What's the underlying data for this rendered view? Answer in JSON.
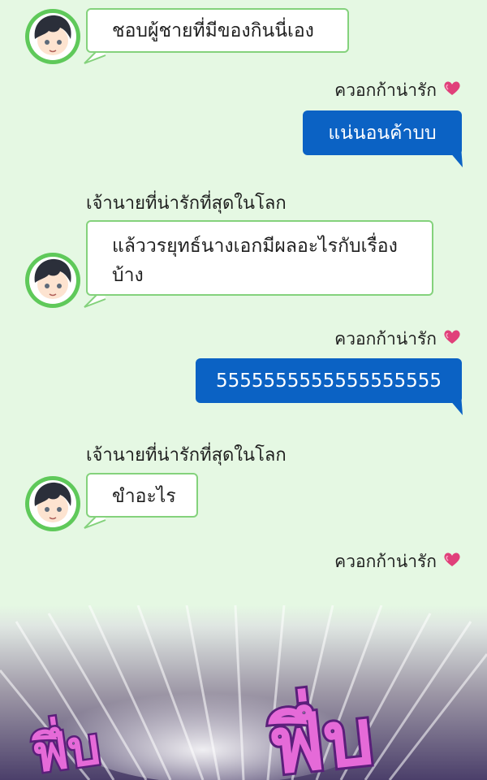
{
  "colors": {
    "background": "#e5f8e3",
    "incoming_bubble_border": "#84d27c",
    "outgoing_bubble": "#0b62c4",
    "heart": "#e0407a"
  },
  "messages": [
    {
      "from": "other",
      "text": "ชอบผู้ชายที่มีของกินนี่เอง"
    },
    {
      "from": "me",
      "sender": "ควอกก้าน่ารัก",
      "text": "แน่นอนค้าบบ"
    },
    {
      "from": "other",
      "sender": "เจ้านายที่น่ารักที่สุดในโลก",
      "text_line1": "แล้ววรยุทธ์นางเอกมีผลอะไรกับเรื่อง",
      "text_line2": "บ้าง"
    },
    {
      "from": "me",
      "sender": "ควอกก้าน่ารัก",
      "text": "5555555555555555555"
    },
    {
      "from": "other",
      "sender": "เจ้านายที่น่ารักที่สุดในโลก",
      "text": "ขำอะไร"
    },
    {
      "from": "me",
      "sender": "ควอกก้าน่ารัก"
    }
  ],
  "sfx": {
    "left": "ฟึ่บ",
    "right": "ฟึ่บ"
  }
}
